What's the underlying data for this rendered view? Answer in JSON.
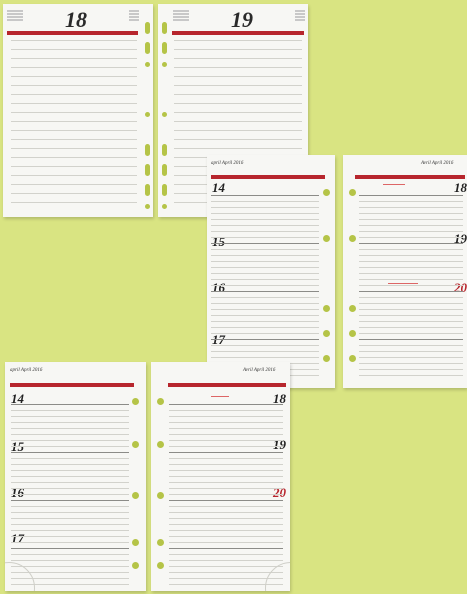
{
  "top_pages": {
    "left_day": "18",
    "right_day": "19"
  },
  "week_set_1": {
    "left_header": "april April 2016",
    "right_header": "Avril April 2016",
    "left_days": [
      "14",
      "15",
      "16",
      "17"
    ],
    "right_days": [
      "18",
      "19",
      "20"
    ]
  },
  "week_set_2": {
    "left_header": "april April 2016",
    "right_header": "Avril April 2016",
    "left_days": [
      "14",
      "15",
      "16",
      "17"
    ],
    "right_days": [
      "18",
      "19",
      "20"
    ]
  },
  "colors": {
    "background": "#d9e482",
    "accent_red": "#b7262d",
    "hole_green": "#b5c447",
    "paper": "#f7f7f4"
  }
}
